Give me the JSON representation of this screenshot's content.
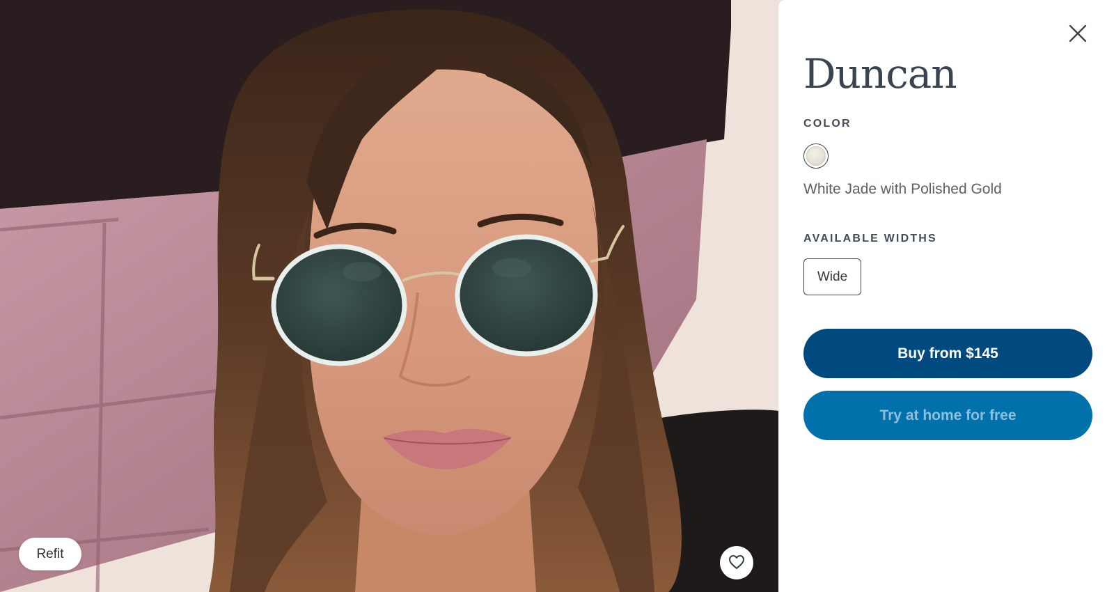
{
  "tryon": {
    "refit_label": "Refit",
    "favorite_icon": "heart-icon"
  },
  "product": {
    "name": "Duncan",
    "close_icon": "close-icon",
    "color_section_label": "COLOR",
    "selected_color": "White Jade with Polished Gold",
    "widths_section_label": "AVAILABLE WIDTHS",
    "widths": [
      "Wide"
    ],
    "buy_label": "Buy from $145",
    "try_label": "Try at home for free"
  },
  "colors": {
    "primary_button": "#004a80",
    "secondary_button": "#0071ab",
    "title_text": "#3a4350"
  }
}
